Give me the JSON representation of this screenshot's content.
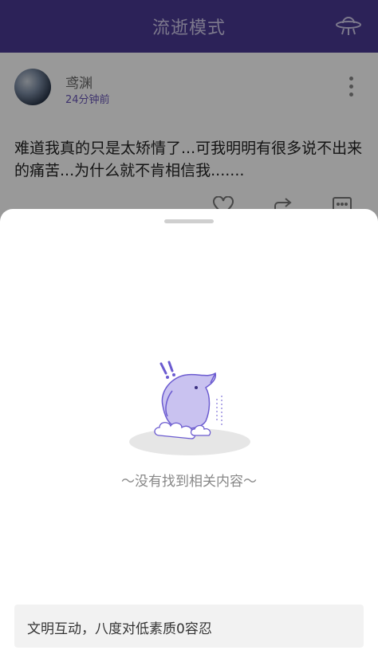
{
  "header": {
    "title": "流逝模式",
    "right_icon": "ufo-icon"
  },
  "post": {
    "username": "鸢渊",
    "time": "24分钟前",
    "content": "难道我真的只是太矫情了...可我明明有很多说不出来的痛苦...为什么就不肯相信我.......",
    "actions": [
      "heart-icon",
      "share-icon",
      "comment-icon"
    ]
  },
  "sheet": {
    "empty_text": "〜没有找到相关内容〜",
    "comment_placeholder": "文明互动，八度对低素质0容忍"
  },
  "colors": {
    "header_bg": "#4a3a93",
    "accent": "#6a58b8"
  }
}
